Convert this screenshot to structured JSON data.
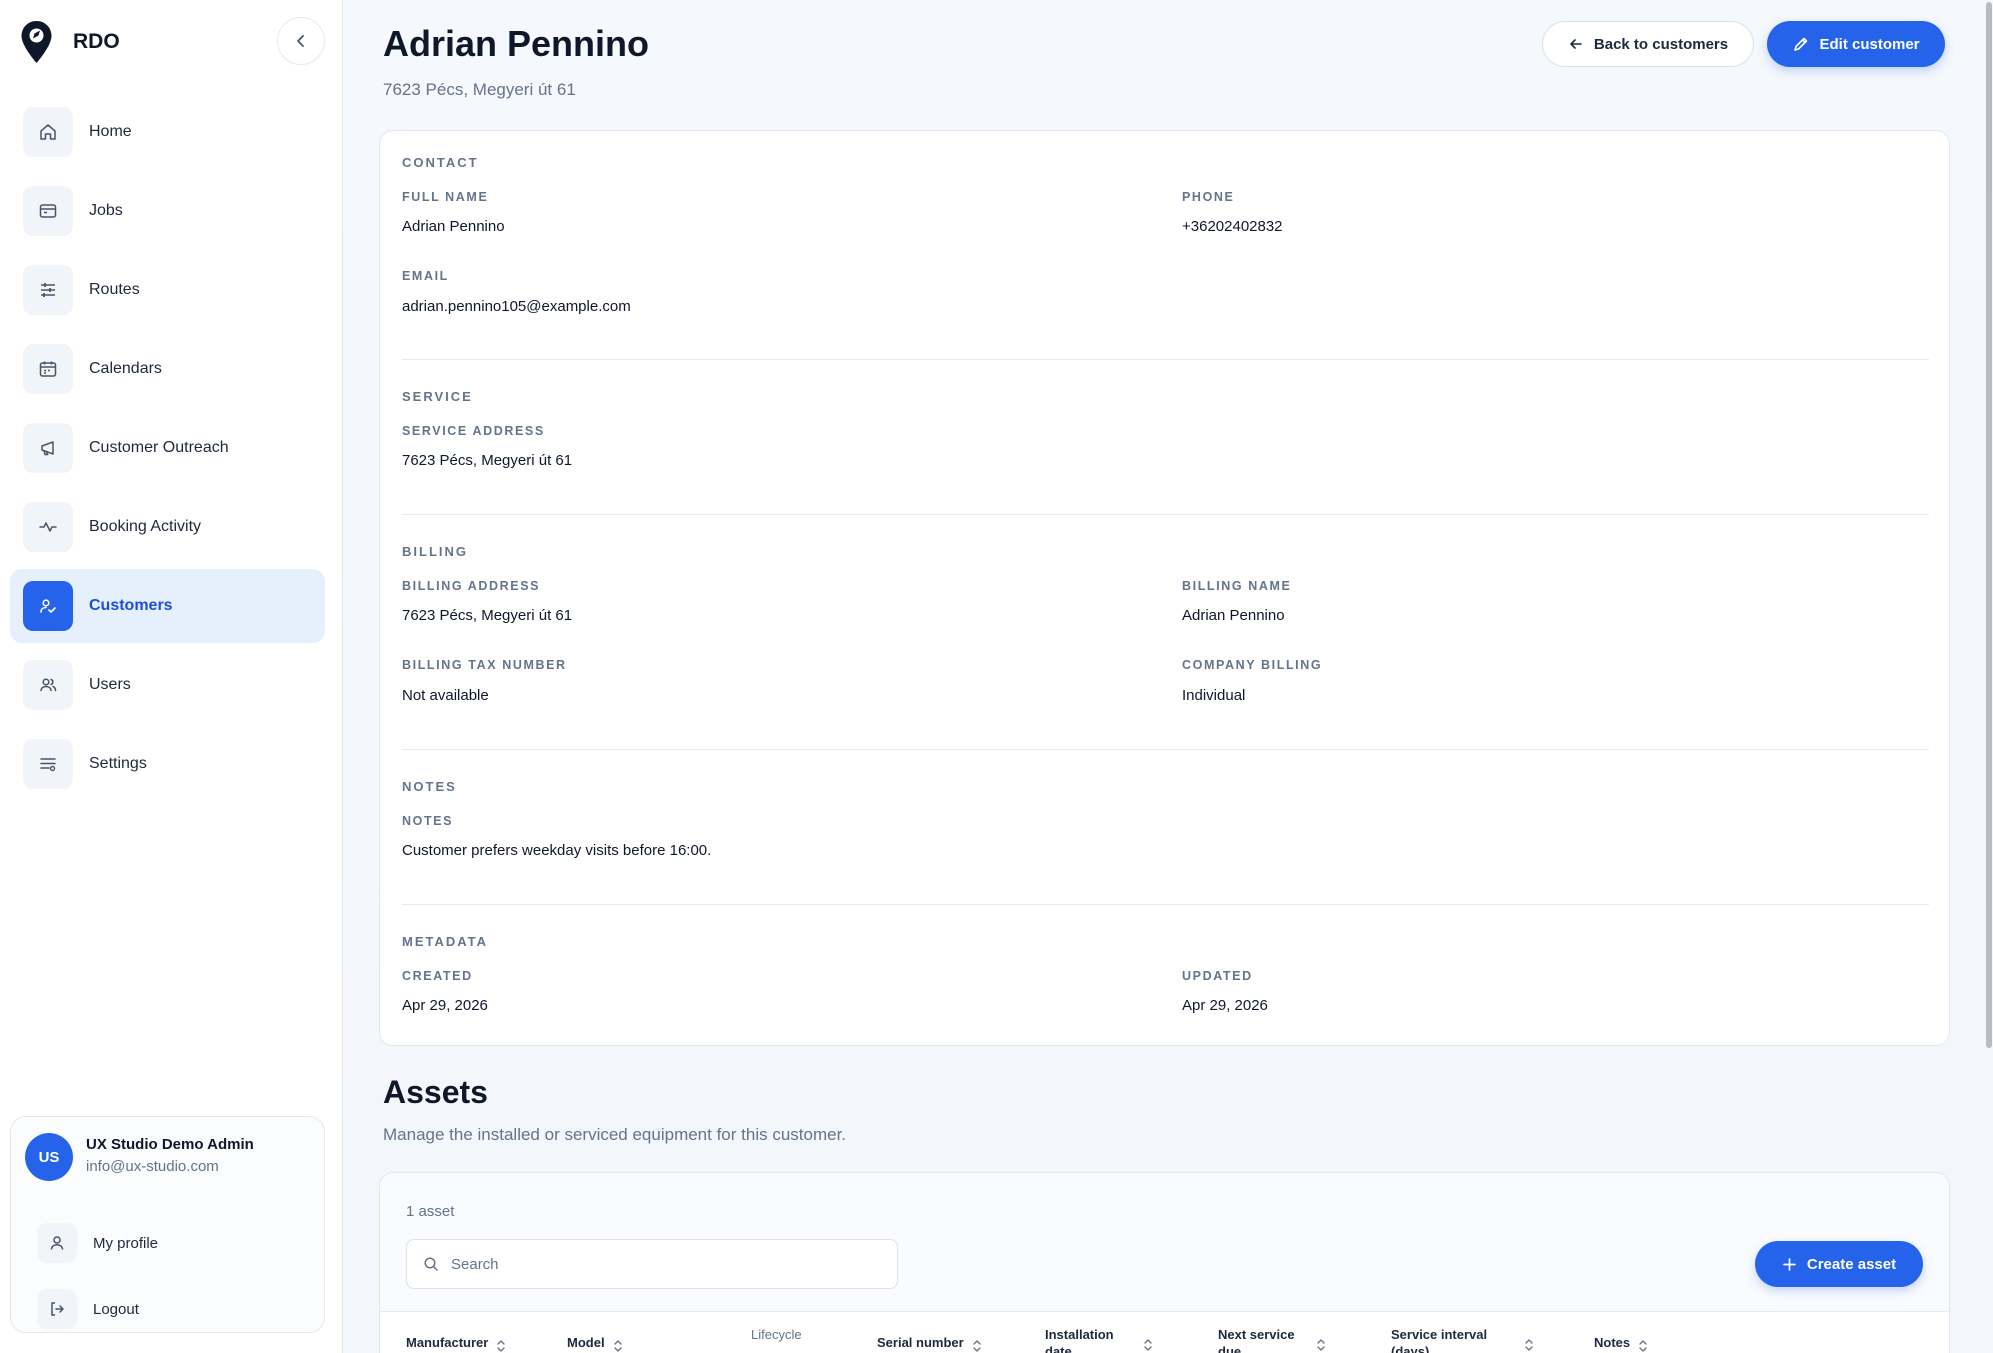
{
  "app": {
    "name": "RDO"
  },
  "sidebar": {
    "items": [
      {
        "label": "Home",
        "icon": "home-icon"
      },
      {
        "label": "Jobs",
        "icon": "briefcase-icon"
      },
      {
        "label": "Routes",
        "icon": "sliders-icon"
      },
      {
        "label": "Calendars",
        "icon": "calendar-icon"
      },
      {
        "label": "Customer Outreach",
        "icon": "megaphone-icon"
      },
      {
        "label": "Booking Activity",
        "icon": "activity-icon"
      },
      {
        "label": "Customers",
        "icon": "customers-icon",
        "active": true
      },
      {
        "label": "Users",
        "icon": "users-icon"
      },
      {
        "label": "Settings",
        "icon": "settings-list-icon"
      }
    ],
    "user": {
      "initials": "US",
      "name": "UX Studio Demo Admin",
      "email": "info@ux-studio.com",
      "profile_label": "My profile",
      "logout_label": "Logout"
    }
  },
  "header": {
    "title": "Adrian Pennino",
    "subtitle": "7623 Pécs, Megyeri út 61",
    "back_label": "Back to customers",
    "edit_label": "Edit customer"
  },
  "contact": {
    "section": "CONTACT",
    "full_name_label": "FULL NAME",
    "full_name": "Adrian Pennino",
    "phone_label": "PHONE",
    "phone": "+36202402832",
    "email_label": "EMAIL",
    "email": "adrian.pennino105@example.com"
  },
  "service": {
    "section": "SERVICE",
    "address_label": "SERVICE ADDRESS",
    "address": "7623 Pécs, Megyeri út 61"
  },
  "billing": {
    "section": "BILLING",
    "address_label": "BILLING ADDRESS",
    "address": "7623 Pécs, Megyeri út 61",
    "name_label": "BILLING NAME",
    "name": "Adrian Pennino",
    "tax_label": "BILLING TAX NUMBER",
    "tax": "Not available",
    "company_label": "COMPANY BILLING",
    "company": "Individual"
  },
  "notes": {
    "section": "NOTES",
    "notes_label": "NOTES",
    "notes": "Customer prefers weekday visits before 16:00."
  },
  "metadata": {
    "section": "METADATA",
    "created_label": "CREATED",
    "created": "Apr 29, 2026",
    "updated_label": "UPDATED",
    "updated": "Apr 29, 2026"
  },
  "assets": {
    "title": "Assets",
    "subtitle": "Manage the installed or serviced equipment for this customer.",
    "count": "1 asset",
    "search_placeholder": "Search",
    "create_label": "Create asset",
    "columns": [
      "Manufacturer",
      "Model",
      "Lifecycle",
      "Serial number",
      "Installation date",
      "Next service due",
      "Service interval (days)",
      "Notes"
    ]
  },
  "colors": {
    "accent": "#2563eb",
    "active_bg": "#e6f0fd",
    "muted": "#64748b"
  }
}
